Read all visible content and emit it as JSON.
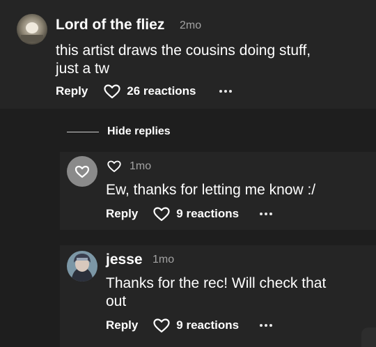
{
  "comment": {
    "author": "Lord of the fliez",
    "time": "2mo",
    "text_line1": "this artist draws the cousins doing stuff,",
    "text_line2": "just a tw",
    "reply_label": "Reply",
    "reactions_label": "26 reactions",
    "more_icon": "more-dots-icon"
  },
  "thread": {
    "hide_replies_label": "Hide replies"
  },
  "replies": [
    {
      "time": "1mo",
      "text_line1": "Ew, thanks for letting me know :/",
      "reply_label": "Reply",
      "reactions_label": "9 reactions"
    },
    {
      "author": "jesse",
      "time": "1mo",
      "text_line1": "Thanks for the rec! Will check that",
      "text_line2": "out",
      "reply_label": "Reply",
      "reactions_label": "9 reactions"
    }
  ],
  "colors": {
    "background": "#1e1e1e",
    "card": "#252525",
    "text": "#ffffff",
    "muted": "#a3a3a3"
  },
  "icons": [
    "heart-icon",
    "more-dots-icon",
    "avatar-heart-icon"
  ]
}
